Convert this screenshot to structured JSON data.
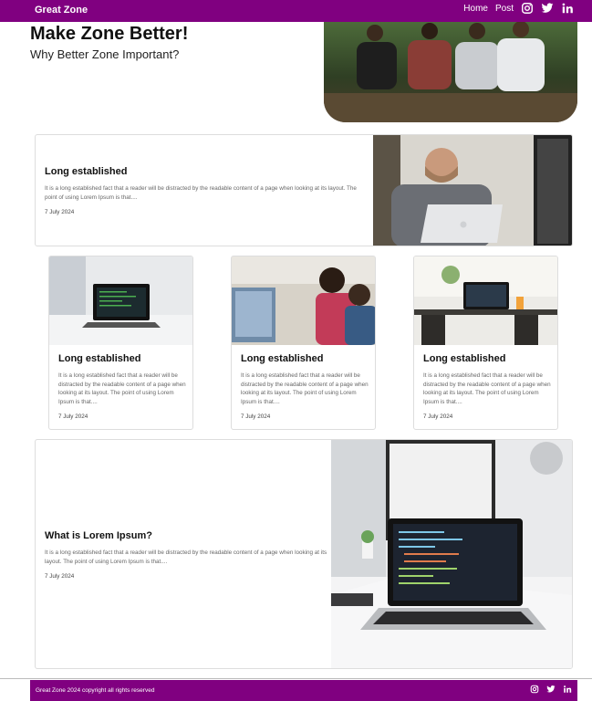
{
  "nav": {
    "brand": "Great Zone",
    "links": [
      "Home",
      "Post"
    ],
    "icons": [
      "instagram-icon",
      "twitter-icon",
      "linkedin-icon"
    ],
    "color": "#800080"
  },
  "hero": {
    "title": "Make Zone Better!",
    "subtitle": "Why Better Zone Important?"
  },
  "cards": {
    "featured": {
      "title": "Long established",
      "desc": "It is a long established fact that a reader will be distracted by the readable content of a page when looking at its layout. The point of using Lorem Ipsum is that....",
      "date": "7 July 2024"
    },
    "grid": [
      {
        "title": "Long established",
        "desc": "It is a long established fact that a reader will be distracted by the readable content of a page when looking at its layout. The point of using Lorem Ipsum is that....",
        "date": "7 July 2024"
      },
      {
        "title": "Long established",
        "desc": "It is a long established fact that a reader will be distracted by the readable content of a page when looking at its layout. The point of using Lorem Ipsum is that....",
        "date": "7 July 2024"
      },
      {
        "title": "Long established",
        "desc": "It is a long established fact that a reader will be distracted by the readable content of a page when looking at its layout. The point of using Lorem Ipsum is that....",
        "date": "7 July 2024"
      }
    ],
    "bottom": {
      "title": "What is Lorem Ipsum?",
      "desc": "It is a long established fact that a reader will be distracted by the readable content of a page when looking at its layout. The point of using Lorem Ipsum is that....",
      "date": "7 July 2024"
    }
  },
  "footer": {
    "text": "Great Zone 2024 copyright all rights reserved",
    "icons": [
      "instagram-icon",
      "twitter-icon",
      "linkedin-icon"
    ]
  }
}
